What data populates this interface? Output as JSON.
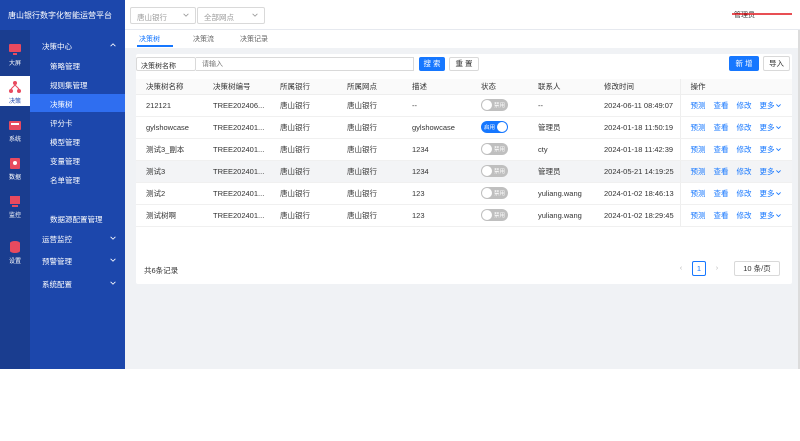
{
  "header": {
    "brand_title": "唐山银行数字化智能运营平台",
    "bank_select": "唐山银行",
    "branch_select": "全部网点",
    "user_name": "管理员"
  },
  "rail": [
    {
      "label": "大屏",
      "icon": "screen-icon"
    },
    {
      "label": "决策",
      "icon": "decision-tree-icon"
    },
    {
      "label": "系统",
      "icon": "system-icon"
    },
    {
      "label": "数据",
      "icon": "data-icon"
    },
    {
      "label": "监控",
      "icon": "monitor-icon"
    },
    {
      "label": "设置",
      "icon": "settings-icon"
    }
  ],
  "menu": {
    "group1": "决策中心",
    "items": [
      "策略管理",
      "规则集管理",
      "决策树",
      "评分卡",
      "模型管理",
      "变量管理",
      "名单管理",
      "数据源配置管理"
    ],
    "active_index": 2,
    "group2": "运营监控",
    "group3": "预警管理",
    "group4": "系统配置"
  },
  "tabs": [
    "决策树",
    "决策流",
    "决策记录"
  ],
  "toolbar": {
    "field_select": "决策树名称",
    "search_placeholder": "请输入",
    "search_button": "搜 索",
    "reset_button": "重 置",
    "new_button": "新 增",
    "import_button": "导入"
  },
  "table": {
    "columns": [
      "决策树名称",
      "决策树编号",
      "所属银行",
      "所属网点",
      "描述",
      "状态",
      "联系人",
      "修改时间",
      "操作"
    ],
    "rows": [
      {
        "name": "212121",
        "code": "TREE202406...",
        "bank": "唐山银行",
        "branch": "唐山银行",
        "desc": "--",
        "status": "禁用",
        "on": false,
        "contact": "--",
        "time": "2024-06-11 08:49:07",
        "highlight": false
      },
      {
        "name": "gylshowcase",
        "code": "TREE202401...",
        "bank": "唐山银行",
        "branch": "唐山银行",
        "desc": "gylshowcase",
        "status": "启用",
        "on": true,
        "contact": "管理员",
        "time": "2024-01-18 11:50:19",
        "highlight": false
      },
      {
        "name": "测试3_副本",
        "code": "TREE202401...",
        "bank": "唐山银行",
        "branch": "唐山银行",
        "desc": "1234",
        "status": "禁用",
        "on": false,
        "contact": "cty",
        "time": "2024-01-18 11:42:39",
        "highlight": false
      },
      {
        "name": "测试3",
        "code": "TREE202401...",
        "bank": "唐山银行",
        "branch": "唐山银行",
        "desc": "1234",
        "status": "禁用",
        "on": false,
        "contact": "管理员",
        "time": "2024-05-21 14:19:25",
        "highlight": true
      },
      {
        "name": "测试2",
        "code": "TREE202401...",
        "bank": "唐山银行",
        "branch": "唐山银行",
        "desc": "123",
        "status": "禁用",
        "on": false,
        "contact": "yuliang.wang",
        "time": "2024-01-02 18:46:13",
        "highlight": false
      },
      {
        "name": "测试树啊",
        "code": "TREE202401...",
        "bank": "唐山银行",
        "branch": "唐山银行",
        "desc": "123",
        "status": "禁用",
        "on": false,
        "contact": "yuliang.wang",
        "time": "2024-01-02 18:29:45",
        "highlight": false
      }
    ],
    "ops": [
      "预测",
      "查看",
      "修改",
      "更多"
    ]
  },
  "pagination": {
    "total_text": "共6条记录",
    "current_page": "1",
    "page_size": "10 条/页"
  },
  "colors": {
    "brand": "#1c47ac",
    "rail": "#1a3d8f",
    "primary": "#1677ff",
    "menu_active": "#2f6ef0"
  }
}
